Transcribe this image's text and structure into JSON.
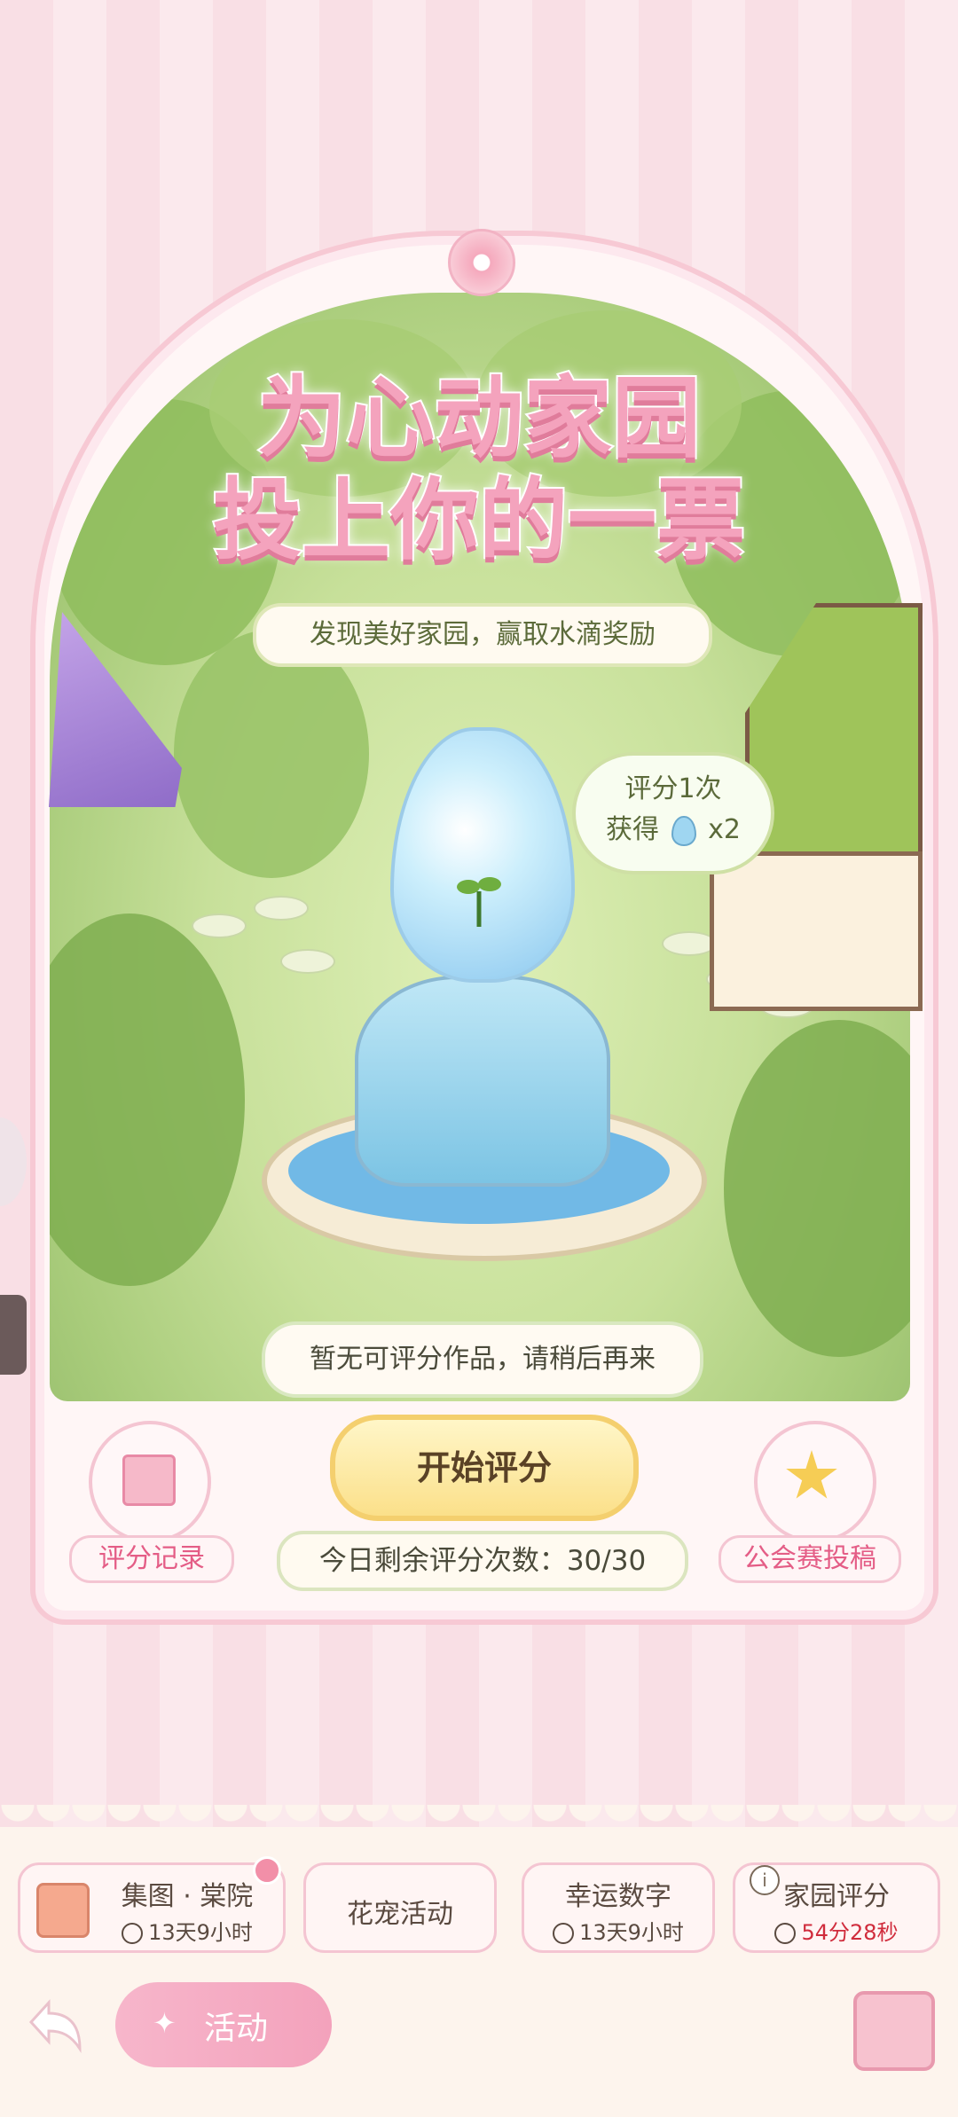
{
  "banner": {
    "title_line1": "为心动家园",
    "title_line2": "投上你的一票",
    "subtitle": "发现美好家园，赢取水滴奖励"
  },
  "reward_bubble": {
    "line1": "评分1次",
    "line2_prefix": "获得",
    "line2_suffix": "x2",
    "icon": "water-drop-icon"
  },
  "notice": "暂无可评分作品，请稍后再来",
  "start_button": "开始评分",
  "remaining": "今日剩余评分次数：30/30",
  "record_label": "评分记录",
  "submit_label": "公会赛投稿",
  "tabs": [
    {
      "title": "集图 · 棠院",
      "timer": "13天9小时",
      "icon": "book-icon"
    },
    {
      "title": "花宠活动"
    },
    {
      "title": "幸运数字",
      "timer": "13天9小时"
    },
    {
      "title": "家园评分",
      "timer": "54分28秒",
      "icon": "info-icon"
    }
  ],
  "activity_label": "活动",
  "colors": {
    "pink_accent": "#e45d86",
    "timer_red": "#d02c3c",
    "button_yellow": "#fbe08a",
    "stripe_pink": "#f9dfe5"
  }
}
